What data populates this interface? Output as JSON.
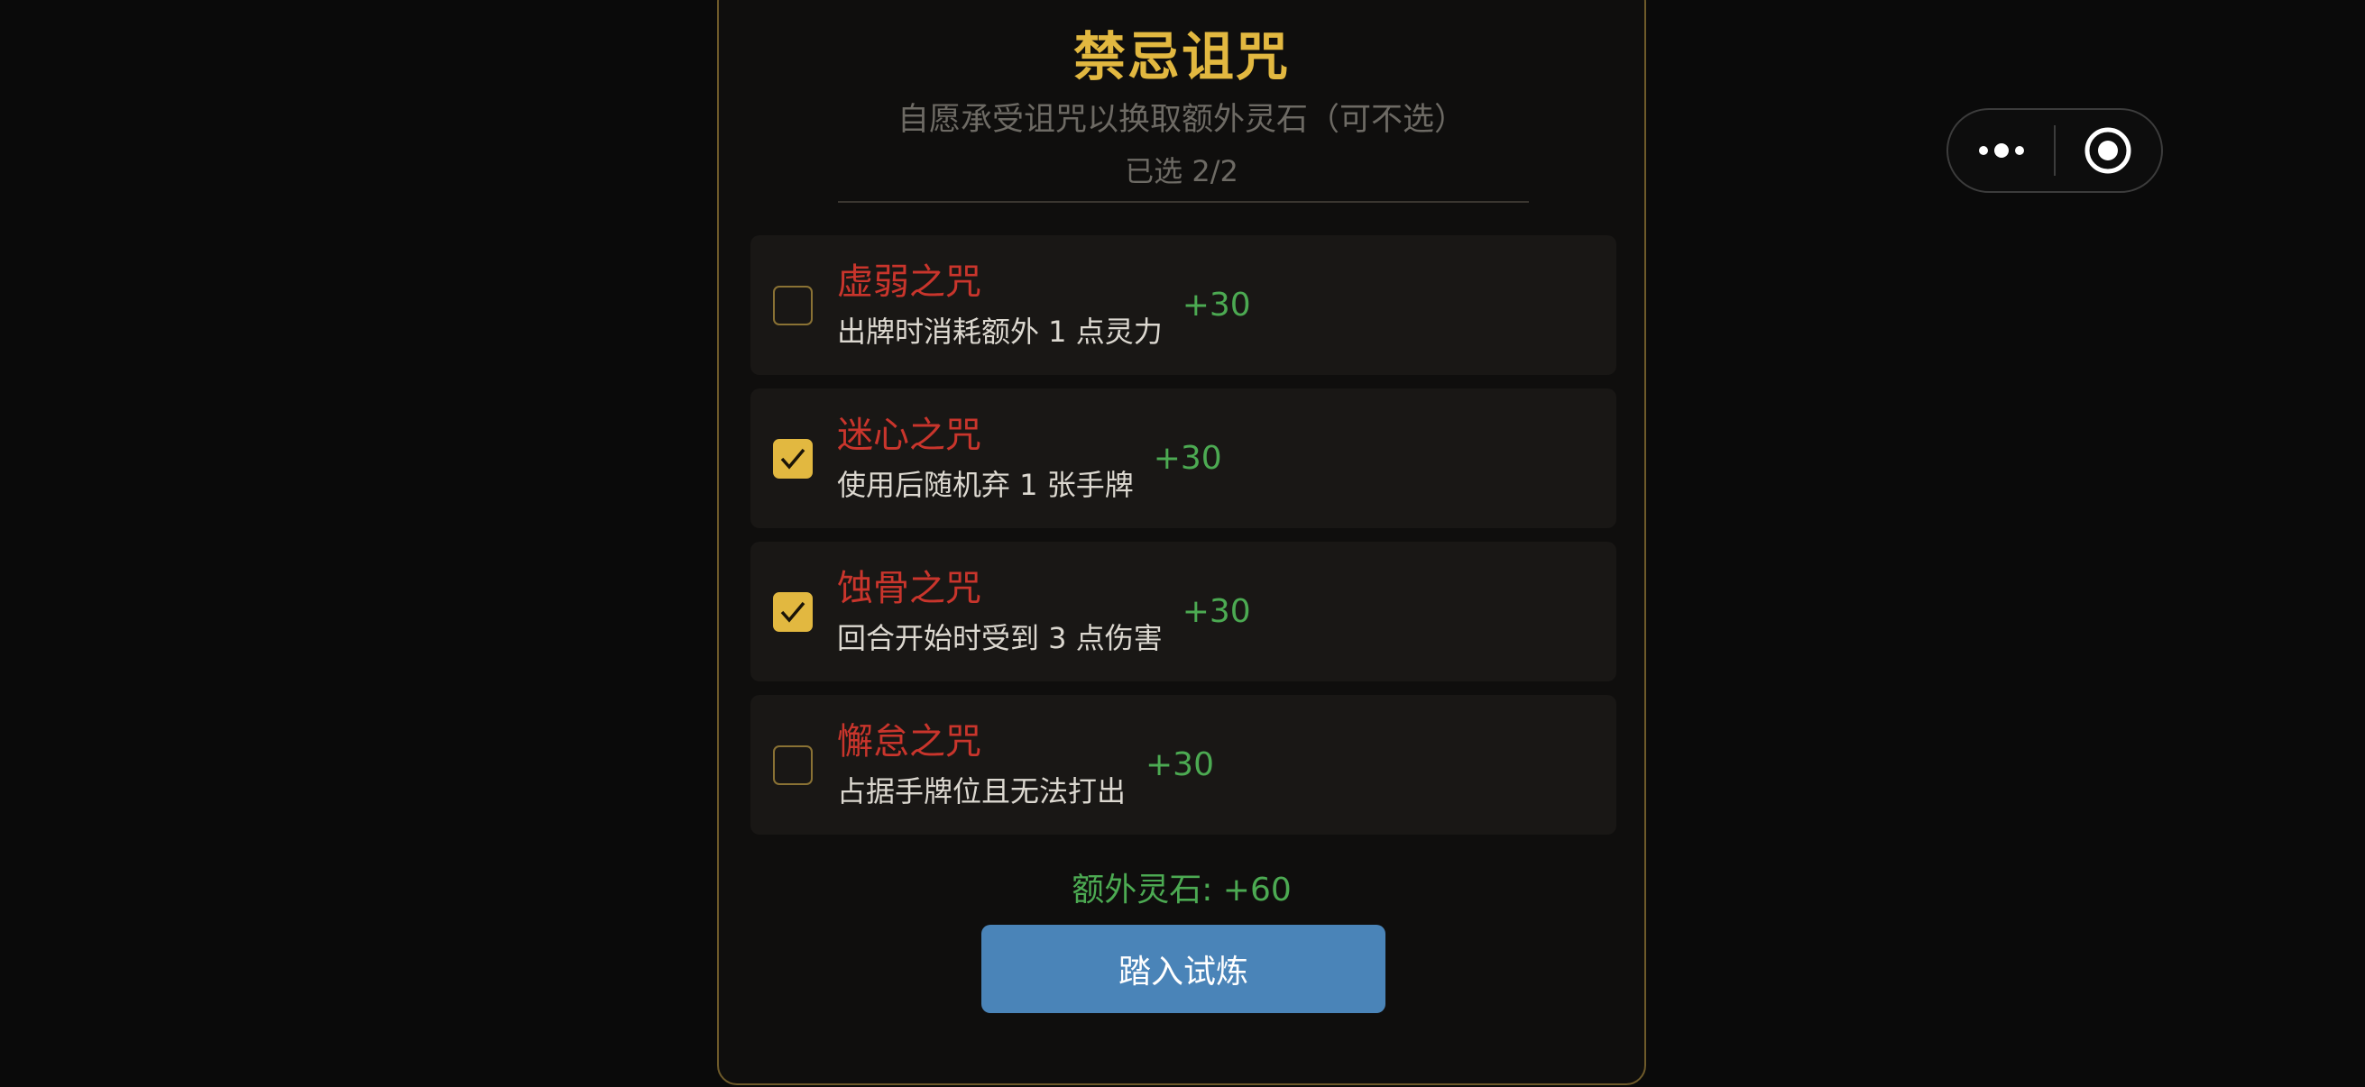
{
  "panel": {
    "title": "禁忌诅咒",
    "subtitle": "自愿承受诅咒以换取额外灵石（可不选）",
    "selected_count": "已选 2/2"
  },
  "curses": [
    {
      "name": "虚弱之咒",
      "desc": "出牌时消耗额外 1 点灵力",
      "reward": "+30",
      "checked": false
    },
    {
      "name": "迷心之咒",
      "desc": "使用后随机弃 1 张手牌",
      "reward": "+30",
      "checked": true
    },
    {
      "name": "蚀骨之咒",
      "desc": "回合开始时受到 3 点伤害",
      "reward": "+30",
      "checked": true
    },
    {
      "name": "懈怠之咒",
      "desc": "占据手牌位且无法打出",
      "reward": "+30",
      "checked": false
    }
  ],
  "extra_stones": "额外灵石: +60",
  "enter_button": "踏入试炼",
  "capsule": {
    "more_icon": "more-dots-icon",
    "close_icon": "target-close-icon"
  },
  "colors": {
    "accent_gold": "#e2b840",
    "curse_red": "#c9352c",
    "reward_green": "#4caa52",
    "button_blue": "#4a84b8"
  }
}
